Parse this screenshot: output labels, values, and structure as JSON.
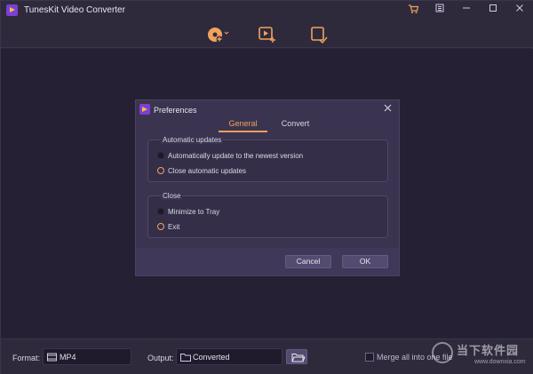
{
  "app": {
    "title": "TunesKit Video Converter"
  },
  "titlebar": {
    "icons": [
      "cart-icon",
      "menu-icon",
      "minimize-icon",
      "maximize-icon",
      "close-icon"
    ]
  },
  "toolbar": {
    "icons": [
      "add-dvd-icon",
      "add-files-icon",
      "converted-history-icon"
    ]
  },
  "colors": {
    "accent": "#f2a25c",
    "background": "#252033",
    "dialog": "#3a3450"
  },
  "dialog": {
    "title": "Preferences",
    "tabs": [
      {
        "label": "General",
        "active": true
      },
      {
        "label": "Convert",
        "active": false
      }
    ],
    "automatic_updates": {
      "label": "Automatic updates",
      "options": [
        {
          "label": "Automatically update to the newest version",
          "selected": false
        },
        {
          "label": "Close automatic updates",
          "selected": true
        }
      ]
    },
    "close": {
      "label": "Close",
      "options": [
        {
          "label": "Minimize to Tray",
          "selected": false
        },
        {
          "label": "Exit",
          "selected": true
        }
      ]
    },
    "cancel_label": "Cancel",
    "ok_label": "OK"
  },
  "bottombar": {
    "format_label": "Format:",
    "format_value": "MP4",
    "output_label": "Output:",
    "output_value": "Converted",
    "merge_label": "Merge all into one file"
  },
  "watermark": {
    "text": "当下软件园",
    "url": "www.downxia.com"
  }
}
